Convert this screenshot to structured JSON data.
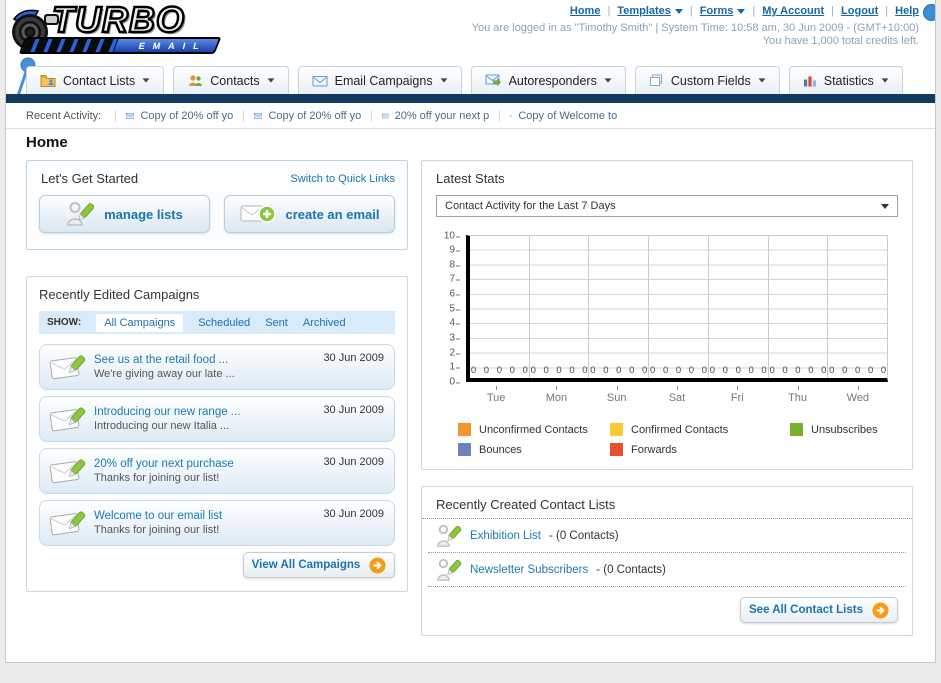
{
  "header": {
    "logo": {
      "word": "TURBO",
      "sub": "EMAIL"
    },
    "links": [
      {
        "label": "Home",
        "dropdown": false
      },
      {
        "label": "Templates",
        "dropdown": true
      },
      {
        "label": "Forms",
        "dropdown": true
      },
      {
        "label": "My Account",
        "dropdown": false
      },
      {
        "label": "Logout",
        "dropdown": false
      },
      {
        "label": "Help",
        "dropdown": false
      }
    ],
    "login_line": "You are logged in as \"Timothy Smith\" | System Time: 10:58 am, 30 Jun 2009 - (GMT+10:00)",
    "credits_line": "You have 1,000 total credits left."
  },
  "nav": {
    "tabs": [
      {
        "label": "Contact Lists",
        "icon": "folder-user-icon"
      },
      {
        "label": "Contacts",
        "icon": "people-icon"
      },
      {
        "label": "Email Campaigns",
        "icon": "envelope-icon"
      },
      {
        "label": "Autoresponders",
        "icon": "envelope-arrow-icon"
      },
      {
        "label": "Custom Fields",
        "icon": "pages-icon"
      },
      {
        "label": "Statistics",
        "icon": "bar-chart-icon"
      }
    ]
  },
  "recent_activity": {
    "label": "Recent Activity:",
    "items": [
      "Copy of 20% off yo",
      "Copy of 20% off yo",
      "20% off your next p",
      "Copy of Welcome to"
    ]
  },
  "page_title": "Home",
  "get_started": {
    "title": "Let's Get Started",
    "switch_link": "Switch to Quick Links",
    "manage_lists_label": "manage lists",
    "create_email_label": "create an email"
  },
  "campaigns": {
    "title": "Recently Edited Campaigns",
    "show_label": "SHOW:",
    "tabs": [
      "All Campaigns",
      "Scheduled",
      "Sent",
      "Archived"
    ],
    "selected_tab": "All Campaigns",
    "items": [
      {
        "title": "See us at the retail food ...",
        "subtitle": "We're giving away our late ...",
        "date": "30 Jun 2009"
      },
      {
        "title": "Introducing our new range ...",
        "subtitle": "Introducing our new Italia ...",
        "date": "30 Jun 2009"
      },
      {
        "title": "20% off your next purchase",
        "subtitle": "Thanks for joining our list!",
        "date": "30 Jun 2009"
      },
      {
        "title": "Welcome to our email list",
        "subtitle": "Thanks for joining our list!",
        "date": "30 Jun 2009"
      }
    ],
    "view_all_label": "View All Campaigns"
  },
  "stats": {
    "title": "Latest Stats",
    "dropdown_value": "Contact Activity for the Last 7 Days"
  },
  "chart_data": {
    "type": "bar",
    "title": "Contact Activity for the Last 7 Days",
    "categories": [
      "Tue",
      "Mon",
      "Sun",
      "Sat",
      "Fri",
      "Thu",
      "Wed"
    ],
    "series": [
      {
        "name": "Unconfirmed Contacts",
        "color": "#F0952F",
        "values": [
          0,
          0,
          0,
          0,
          0,
          0,
          0
        ]
      },
      {
        "name": "Confirmed Contacts",
        "color": "#FBC933",
        "values": [
          0,
          0,
          0,
          0,
          0,
          0,
          0
        ]
      },
      {
        "name": "Unsubscribes",
        "color": "#79AE2C",
        "values": [
          0,
          0,
          0,
          0,
          0,
          0,
          0
        ]
      },
      {
        "name": "Bounces",
        "color": "#6B83B5",
        "values": [
          0,
          0,
          0,
          0,
          0,
          0,
          0
        ]
      },
      {
        "name": "Forwards",
        "color": "#E8502D",
        "values": [
          0,
          0,
          0,
          0,
          0,
          0,
          0
        ]
      }
    ],
    "per_day_values": [
      [
        0,
        0,
        0,
        0,
        0
      ],
      [
        0,
        0,
        0,
        0,
        0
      ],
      [
        0,
        0,
        0,
        0,
        0
      ],
      [
        0,
        0,
        0,
        0,
        0
      ],
      [
        0,
        0,
        0,
        0,
        0
      ],
      [
        0,
        0,
        0,
        0,
        0
      ],
      [
        0,
        0,
        0,
        0,
        0
      ]
    ],
    "ylim": [
      0,
      10
    ],
    "yticks": [
      10,
      9,
      8,
      7,
      6,
      5,
      4,
      3,
      2,
      1,
      0
    ],
    "grid": true,
    "legend_position": "bottom"
  },
  "contact_lists": {
    "title": "Recently Created Contact Lists",
    "items": [
      {
        "name": "Exhibition List",
        "suffix": "- (0 Contacts)"
      },
      {
        "name": "Newsletter Subscribers",
        "suffix": "- (0 Contacts)"
      }
    ],
    "see_all_label": "See All Contact Lists"
  },
  "colors": {
    "navy_bar": "#143A60",
    "link_blue": "#1B74AD",
    "accent_orange": "#F59D17",
    "pencil_green": "#8CC63F"
  }
}
